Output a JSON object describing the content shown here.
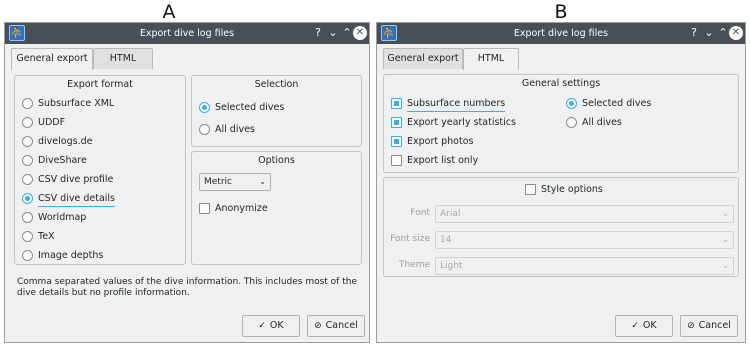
{
  "panel_a": {
    "letter": "A",
    "window_title": "Export dive log files",
    "tabs": [
      {
        "label": "General export"
      },
      {
        "label": "HTML"
      }
    ],
    "export_format": {
      "title": "Export format",
      "options": [
        {
          "label": "Subsurface XML",
          "checked": false
        },
        {
          "label": "UDDF",
          "checked": false
        },
        {
          "label": "divelogs.de",
          "checked": false
        },
        {
          "label": "DiveShare",
          "checked": false
        },
        {
          "label": "CSV dive profile",
          "checked": false
        },
        {
          "label": "CSV dive details",
          "checked": true
        },
        {
          "label": "Worldmap",
          "checked": false
        },
        {
          "label": "TeX",
          "checked": false
        },
        {
          "label": "Image depths",
          "checked": false
        }
      ]
    },
    "selection": {
      "title": "Selection",
      "options": [
        {
          "label": "Selected dives",
          "checked": true
        },
        {
          "label": "All dives",
          "checked": false
        }
      ]
    },
    "options_group": {
      "title": "Options",
      "units_value": "Metric",
      "anonymize_label": "Anonymize",
      "anonymize_checked": false
    },
    "description": "Comma separated values of the dive information. This includes most of the dive details but no profile information.",
    "ok_label": "OK",
    "cancel_label": "Cancel"
  },
  "panel_b": {
    "letter": "B",
    "window_title": "Export dive log files",
    "tabs": [
      {
        "label": "General export"
      },
      {
        "label": "HTML"
      }
    ],
    "general_settings": {
      "title": "General settings",
      "checks": [
        {
          "label": "Subsurface numbers",
          "checked": true
        },
        {
          "label": "Export yearly statistics",
          "checked": true
        },
        {
          "label": "Export photos",
          "checked": true
        },
        {
          "label": "Export list only",
          "checked": false
        }
      ],
      "radios": [
        {
          "label": "Selected dives",
          "checked": true
        },
        {
          "label": "All dives",
          "checked": false
        }
      ]
    },
    "style_options": {
      "title": "Style options",
      "checked": false,
      "font_label": "Font",
      "font_value": "Arial",
      "font_size_label": "Font size",
      "font_size_value": "14",
      "theme_label": "Theme",
      "theme_value": "Light"
    },
    "ok_label": "OK",
    "cancel_label": "Cancel"
  },
  "icons": {
    "help": "?",
    "minimize": "⌄",
    "maximize": "⌃",
    "close": "✕",
    "ok": "✓",
    "cancel": "⊘",
    "dropdown": "⌄"
  },
  "colors": {
    "titlebar": "#475057",
    "accent": "#3daee9",
    "window_bg": "#eff0f1"
  }
}
